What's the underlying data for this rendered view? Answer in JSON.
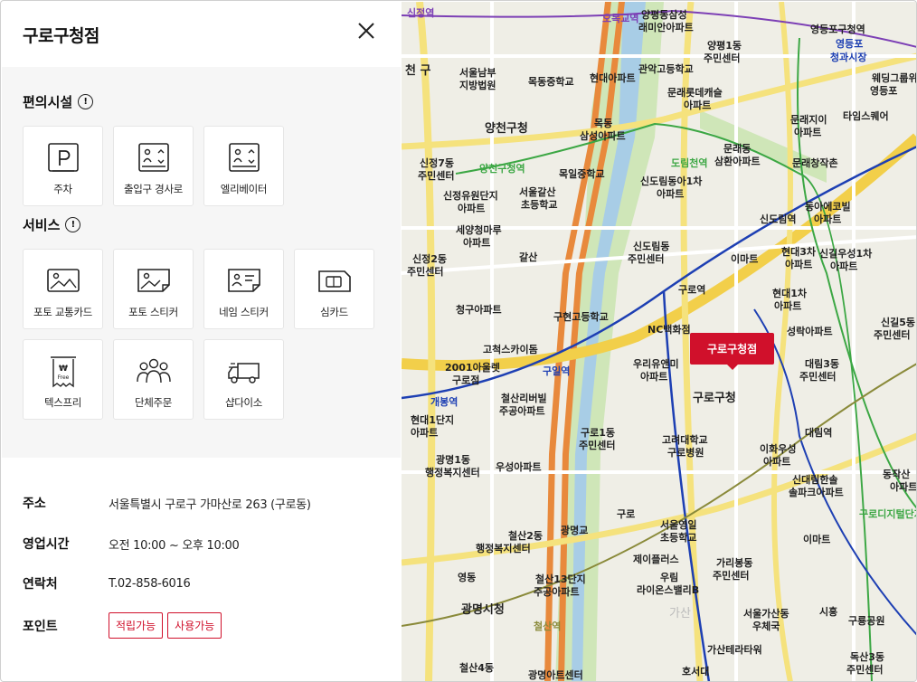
{
  "store_name": "구로구청점",
  "facilities": {
    "title": "편의시설",
    "items": [
      {
        "label": "주차",
        "icon": "parking-icon"
      },
      {
        "label": "출입구 경사로",
        "icon": "ramp-icon"
      },
      {
        "label": "엘리베이터",
        "icon": "elevator-icon"
      }
    ]
  },
  "services": {
    "title": "서비스",
    "items": [
      {
        "label": "포토 교통카드",
        "icon": "photo-card-icon"
      },
      {
        "label": "포토 스티커",
        "icon": "photo-sticker-icon"
      },
      {
        "label": "네임 스티커",
        "icon": "name-sticker-icon"
      },
      {
        "label": "심카드",
        "icon": "sim-card-icon"
      },
      {
        "label": "텍스프리",
        "icon": "tax-free-icon"
      },
      {
        "label": "단체주문",
        "icon": "group-order-icon"
      },
      {
        "label": "샵다이소",
        "icon": "delivery-truck-icon"
      }
    ]
  },
  "info": {
    "address_label": "주소",
    "address": "서울특별시 구로구 가마산로 263 (구로동)",
    "hours_label": "영업시간",
    "hours": "오전 10:00 ~ 오후 10:00",
    "contact_label": "연락처",
    "contact": "T.02-858-6016",
    "points_label": "포인트",
    "points_badges": [
      "적립가능",
      "사용가능"
    ]
  },
  "map": {
    "marker": "구로구청점",
    "labels": [
      "신정역",
      "오목교역",
      "양평동삼성",
      "래미안아파트",
      "영등포구청역",
      "영등포",
      "청과시장",
      "양평1동",
      "주민센터",
      "천 구",
      "서울남부",
      "지방법원",
      "목동중학교",
      "현대아파트",
      "관악고등학교",
      "문래롯데캐슬",
      "아파트",
      "웨딩그룹위더스",
      "영등포",
      "양천구청",
      "목동",
      "삼성아파트",
      "타임스퀘어",
      "문래지이",
      "아파트",
      "신정7동",
      "주민센터",
      "양천구청역",
      "목일중학교",
      "도림천역",
      "문래동",
      "삼환아파트",
      "문래창작촌",
      "신정유원단지",
      "아파트",
      "서울갈산",
      "초등학교",
      "신도림동아1차",
      "아파트",
      "동아에코빌",
      "아파트",
      "신도림역",
      "세양청마루",
      "아파트",
      "신도림동",
      "주민센터",
      "이마트",
      "현대3차",
      "아파트",
      "신길우성1차",
      "아파트",
      "신정2동",
      "주민센터",
      "갈산",
      "구로역",
      "현대1차",
      "아파트",
      "청구아파트",
      "구현고등학교",
      "NC백화점",
      "성락아파트",
      "신길5동",
      "주민센터",
      "고척스카이돔",
      "2001아울렛",
      "구로점",
      "구일역",
      "우리유앤미",
      "아파트",
      "구로구청",
      "대림3동",
      "주민센터",
      "개봉역",
      "철산리버빌",
      "주공아파트",
      "현대1단지",
      "아파트",
      "구로1동",
      "주민센터",
      "고려대학교",
      "구로병원",
      "대림역",
      "이화우성",
      "아파트",
      "광명1동",
      "행정복지센터",
      "우성아파트",
      "신대림한솔",
      "솔파크아파트",
      "동작산",
      "아파트",
      "구로디지털단지",
      "철산2동",
      "행정복지센터",
      "광명교",
      "구로",
      "서울영일",
      "초등학교",
      "이마트",
      "제이플러스",
      "가리봉동",
      "주민센터",
      "영동",
      "철산13단지",
      "주공아파트",
      "우림",
      "라이온스밸리B",
      "광명시청",
      "서울가산동",
      "우체국",
      "시흥",
      "구룡공원",
      "철산역",
      "가산",
      "가산테라타워",
      "독산3동",
      "주민센터",
      "철산4동",
      "광명아트센터",
      "호서대"
    ]
  }
}
